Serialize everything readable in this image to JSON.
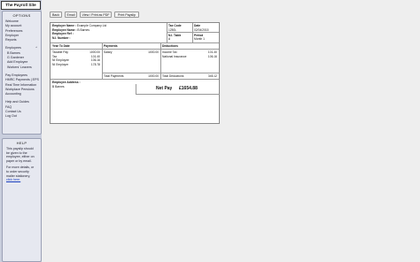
{
  "app": {
    "title": "The Payroll Site"
  },
  "sidebar": {
    "options_title": "OPTIONS",
    "menu": [
      "Welcome",
      "My account",
      "Preferences",
      "Employer",
      "Reports",
      "Employees",
      "B Barnes",
      "G Gardener",
      "Add Employee",
      "Workers' Leavers",
      "Pay Employees",
      "HMRC Payments | EPS",
      "Real Time Information",
      "Workplace Pensions",
      "Accounting",
      "Help and Guides",
      "FAQ",
      "Contact Us",
      "Log Out"
    ],
    "employees_toggle": "^",
    "help_title": "HELP",
    "help_p1": "This payslip should be given to the employee, either on paper or by email.",
    "help_p2": "For more details, or to order security mailer stationery,",
    "help_link": "click here."
  },
  "toolbar": {
    "back": "Back",
    "email": "Email",
    "view_print_pdf": "View / Print as PDF",
    "print_payslip": "Print Payslip"
  },
  "payslip": {
    "employer_name_label": "Employer Name :",
    "employer_name": "Example Company Ltd",
    "employee_name_label": "Employee Name :",
    "employee_name": "B Barnes",
    "employee_ref_label": "Employee Ref :",
    "ni_number_label": "N.I. Number :",
    "tax_code_label": "Tax Code",
    "tax_code": "1250L",
    "date_label": "Date",
    "date": "02/04/2015",
    "ni_table_label": "N.I. Table",
    "ni_table": "A",
    "period_label": "Period",
    "period": "Month 1",
    "ytd_header": "Year To Date",
    "payments_header": "Payments",
    "deductions_header": "Deductions",
    "ytd": [
      {
        "label": "Taxable Pay",
        "value": "1000.00"
      },
      {
        "label": "Tax",
        "value": "101.40"
      },
      {
        "label": "NI Employee",
        "value": "106.16"
      },
      {
        "label": "NI Employer",
        "value": "178.78"
      }
    ],
    "payments": [
      {
        "label": "Salary",
        "value": "1000.00"
      }
    ],
    "deductions": [
      {
        "label": "Income Tax",
        "value": "101.40"
      },
      {
        "label": "National Insurance",
        "value": "106.16"
      }
    ],
    "total_payments_label": "Total Payments",
    "total_payments": "1000.00",
    "total_deductions_label": "Total Deductions",
    "total_deductions": "345.12",
    "employee_address_label": "Employee Address :",
    "employee_address_line1": "B Barnes",
    "net_pay_label": "Net Pay",
    "net_pay": "£1654.88"
  }
}
